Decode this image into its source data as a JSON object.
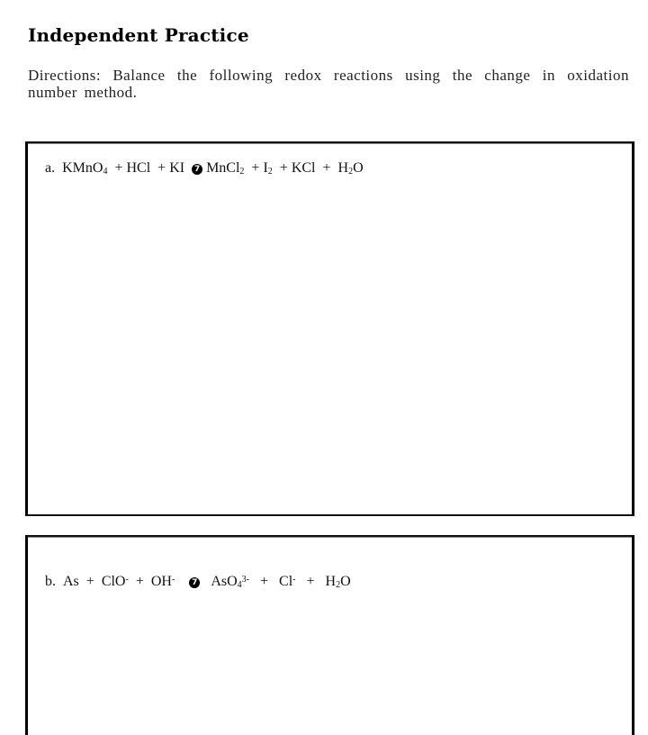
{
  "title": "Independent Practice",
  "directions": "Directions: Balance the following redox reactions using the change in oxidation number method.",
  "problems": [
    {
      "label": "a.",
      "reactants": [
        {
          "base": "KMnO",
          "sub": "4"
        },
        {
          "base": "HCl"
        },
        {
          "base": "KI"
        }
      ],
      "arrow_glyph": "7",
      "arrow_icon": "arrow-icon",
      "products": [
        {
          "base": "MnCl",
          "sub": "2"
        },
        {
          "base": "I",
          "sub": "2"
        },
        {
          "base": "KCl"
        },
        {
          "base": "H",
          "sub": "2",
          "tail": "O"
        }
      ]
    },
    {
      "label": "b.",
      "reactants": [
        {
          "base": "As"
        },
        {
          "base": "ClO",
          "sup": "-"
        },
        {
          "base": "OH",
          "sup": "-"
        }
      ],
      "arrow_glyph": "7",
      "arrow_icon": "arrow-icon",
      "products": [
        {
          "base": "AsO",
          "sub": "4",
          "sup": "3-"
        },
        {
          "base": "Cl",
          "sup": "-"
        },
        {
          "base": "H",
          "sub": "2",
          "tail": "O"
        }
      ]
    }
  ],
  "plus": "+"
}
